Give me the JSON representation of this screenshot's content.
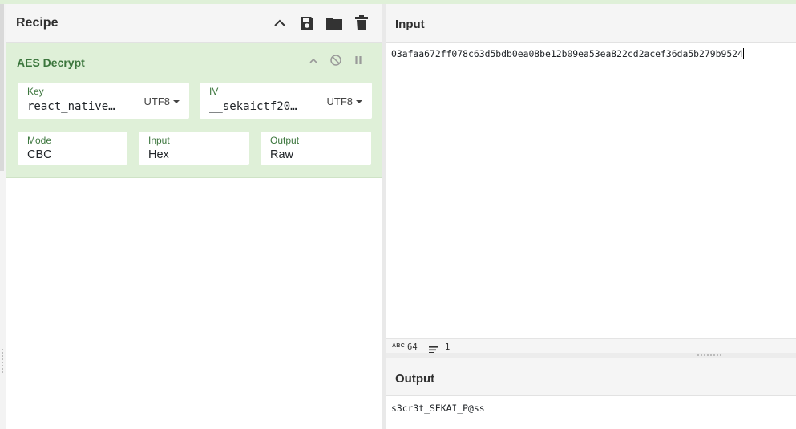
{
  "recipe": {
    "title": "Recipe",
    "icons": [
      "chevron-up-icon",
      "save-icon",
      "folder-icon",
      "trash-icon"
    ]
  },
  "operation": {
    "name": "AES Decrypt",
    "controls": [
      "chevron-up-icon",
      "disable-icon",
      "pause-icon"
    ],
    "key": {
      "label": "Key",
      "value": "react_native…",
      "encoding": "UTF8"
    },
    "iv": {
      "label": "IV",
      "value": "__sekaictf20…",
      "encoding": "UTF8"
    },
    "mode": {
      "label": "Mode",
      "value": "CBC"
    },
    "input": {
      "label": "Input",
      "value": "Hex"
    },
    "output": {
      "label": "Output",
      "value": "Raw"
    }
  },
  "input_pane": {
    "title": "Input",
    "text": "03afaa672ff078c63d5bdb0ea08be12b09ea53ea822cd2acef36da5b279b9524",
    "status": {
      "abc_label": "ABC",
      "length": "64",
      "lines": "1"
    }
  },
  "output_pane": {
    "title": "Output",
    "text": "s3cr3t_SEKAI_P@ss"
  },
  "colors": {
    "operation_bg": "#dff0d8",
    "operation_text": "#3c763d",
    "header_bg": "#f5f5f5"
  }
}
